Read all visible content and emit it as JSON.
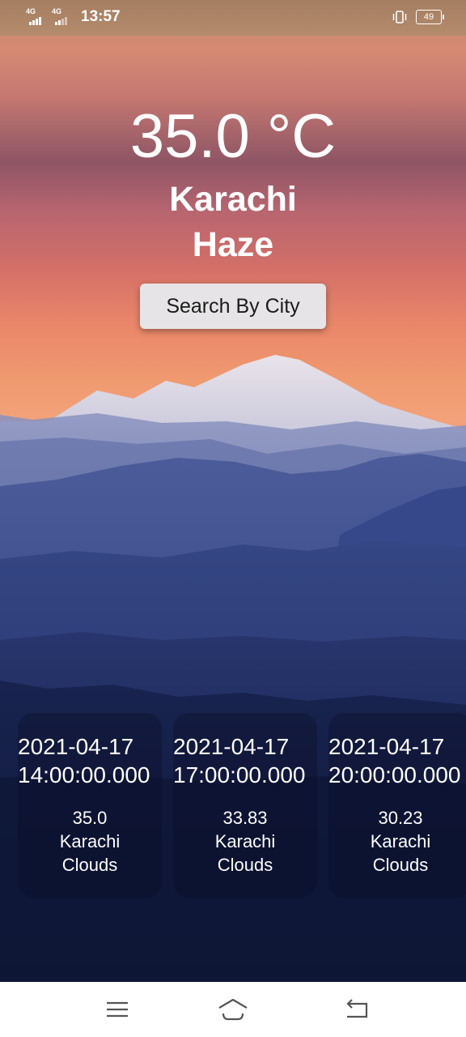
{
  "status_bar": {
    "sim1_network": "4G",
    "sim2_network": "4G",
    "time": "13:57",
    "battery_level": "49",
    "icons": [
      "signal-icon",
      "signal-icon",
      "vibrate-icon",
      "battery-icon"
    ]
  },
  "weather": {
    "temperature": "35.0 °C",
    "city": "Karachi",
    "condition": "Haze"
  },
  "search_button_label": "Search By City",
  "forecast": [
    {
      "date": "2021-04-17",
      "time": "14:00:00.000",
      "temp": "35.0",
      "city": "Karachi",
      "description": "Clouds"
    },
    {
      "date": "2021-04-17",
      "time": "17:00:00.000",
      "temp": "33.83",
      "city": "Karachi",
      "description": "Clouds"
    },
    {
      "date": "2021-04-17",
      "time": "20:00:00.000",
      "temp": "30.23",
      "city": "Karachi",
      "description": "Clouds"
    }
  ],
  "nav_bar": {
    "icons": [
      "menu-icon",
      "home-icon",
      "back-icon"
    ]
  },
  "colors": {
    "text": "#ffffff",
    "button_bg": "#e6e4e6",
    "button_text": "#1b1b1b",
    "card_bg": "rgba(10,14,40,0.38)",
    "nav_icon": "#555555"
  }
}
